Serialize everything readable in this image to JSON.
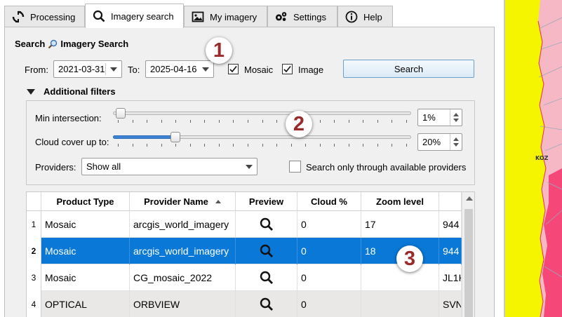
{
  "tabs": [
    {
      "label": "Processing",
      "icon": "processing-icon"
    },
    {
      "label": "Imagery search",
      "icon": "search-icon"
    },
    {
      "label": "My imagery",
      "icon": "image-icon"
    },
    {
      "label": "Settings",
      "icon": "gear-icon"
    },
    {
      "label": "Help",
      "icon": "info-icon"
    }
  ],
  "active_tab": "Imagery search",
  "search": {
    "heading_prefix": "Search",
    "heading_title": "Imagery Search",
    "from_label": "From:",
    "from_value": "2021-03-31",
    "to_label": "To:",
    "to_value": "2025-04-16",
    "mosaic_label": "Mosaic",
    "mosaic_checked": true,
    "image_label": "Image",
    "image_checked": true,
    "search_button": "Search"
  },
  "filters": {
    "title": "Additional filters",
    "min_intersection_label": "Min intersection:",
    "min_intersection_value": "1%",
    "min_intersection_fraction": 0.01,
    "cloud_label": "Cloud cover up to:",
    "cloud_value": "20%",
    "cloud_fraction": 0.2,
    "providers_label": "Providers:",
    "providers_value": "Show all",
    "only_available_label": "Search only through available providers",
    "only_available_checked": false
  },
  "table": {
    "columns": [
      "Product Type",
      "Provider Name",
      "Preview",
      "Cloud %",
      "Zoom level",
      ""
    ],
    "sorted_column": "Provider Name",
    "rows": [
      {
        "num": "1",
        "product_type": "Mosaic",
        "provider": "arcgis_world_imagery",
        "cloud": "0",
        "zoom": "17",
        "extra": "944",
        "selected": false
      },
      {
        "num": "2",
        "product_type": "Mosaic",
        "provider": "arcgis_world_imagery",
        "cloud": "0",
        "zoom": "18",
        "extra": "944",
        "selected": true
      },
      {
        "num": "3",
        "product_type": "Mosaic",
        "provider": "CG_mosaic_2022",
        "cloud": "0",
        "zoom": "",
        "extra": "JL1K",
        "selected": false
      },
      {
        "num": "4",
        "product_type": "OPTICAL",
        "provider": "ORBVIEW",
        "cloud": "0",
        "zoom": "",
        "extra": "SVN",
        "selected": false
      }
    ]
  },
  "callouts": [
    "1",
    "2",
    "3"
  ],
  "map": {
    "label": "KOZ",
    "highlight_color": "#f5f500",
    "area_color": "#f5346a"
  },
  "colors": {
    "selection": "#0a78d7",
    "callout_text": "#9a2b2b"
  }
}
